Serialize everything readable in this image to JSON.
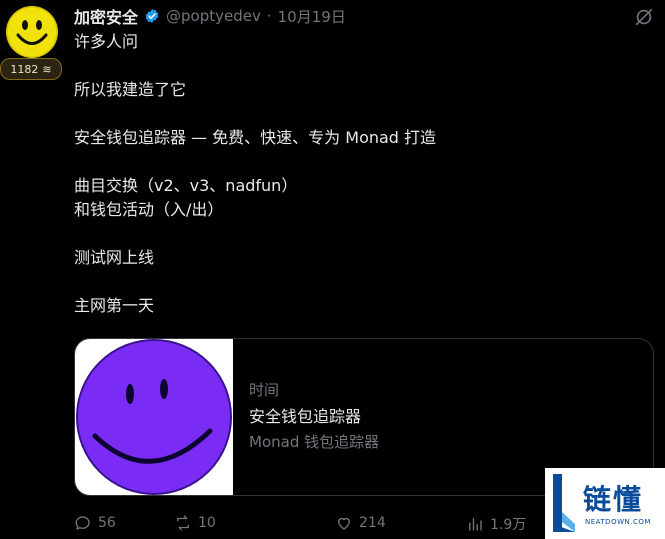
{
  "author": {
    "name": "加密安全",
    "handle": "@poptyedev",
    "separator": "·",
    "date": "10月19日",
    "badge_count": "1182",
    "badge_glyph": "≋"
  },
  "post": {
    "lines": [
      "许多人问",
      "",
      "所以我建造了它",
      "",
      "安全钱包追踪器 — 免费、快速、专为 Monad 打造",
      "",
      "曲目交换（v2、v3、nadfun）",
      "和钱包活动（入/出）",
      "",
      "测试网上线",
      "",
      " 主网第一天"
    ]
  },
  "card": {
    "source": "时间",
    "title": "安全钱包追踪器",
    "description": "Monad 钱包追踪器",
    "thumb_color": "#7a2cf5"
  },
  "actions": {
    "replies": "56",
    "reposts": "10",
    "likes": "214",
    "views": "1.9万"
  },
  "watermark": {
    "title": "链懂",
    "sub": "NEATDOWN.COM"
  },
  "colors": {
    "background": "#000000",
    "text": "#e7e9ea",
    "muted": "#71767b",
    "verified": "#1d9bf0",
    "avatar": "#ece10b"
  }
}
